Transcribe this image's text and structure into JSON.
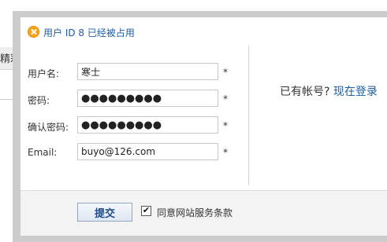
{
  "background": {
    "tab_label": "精彩"
  },
  "dialog": {
    "error_message": "用户 ID 8 已经被占用",
    "fields": {
      "username": {
        "label": "用户名:",
        "value": "寒士",
        "required_mark": "*"
      },
      "password": {
        "label": "密码:",
        "value": "●●●●●●●●●",
        "required_mark": "*"
      },
      "confirm_password": {
        "label": "确认密码:",
        "value": "●●●●●●●●●",
        "required_mark": "*"
      },
      "email": {
        "label": "Email:",
        "value": "buyo@126.com",
        "required_mark": "*"
      }
    },
    "side": {
      "prompt": "已有帐号?",
      "login_link": "现在登录"
    },
    "footer": {
      "submit_label": "提交",
      "agree_checked_mark": "✔",
      "agree_label": "同意网站服务条款"
    }
  },
  "colors": {
    "link": "#1c5ea8",
    "frame": "#cccccc",
    "footer_bg": "#f3f3f3",
    "error_icon": "#f9a51a"
  }
}
